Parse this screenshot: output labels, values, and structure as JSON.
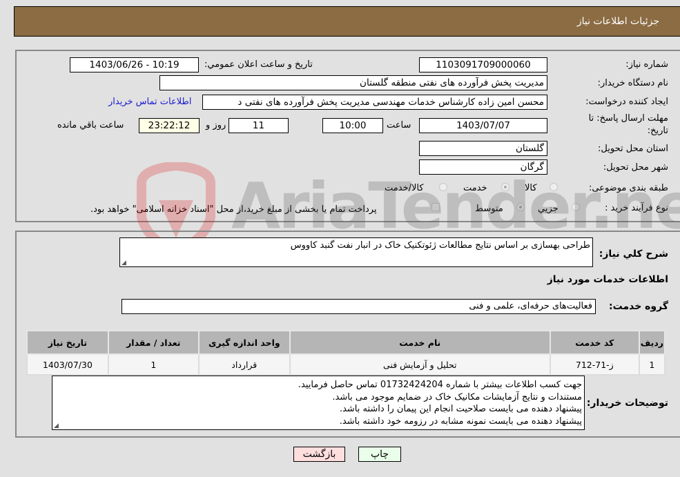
{
  "header": {
    "title": "جزئیات اطلاعات نیاز"
  },
  "form": {
    "need_number_label": "شماره نیاز:",
    "need_number": "1103091709000060",
    "announce_label": "تاریخ و ساعت اعلان عمومي:",
    "announce_value": "1403/06/26 - 10:19",
    "buyer_org_label": "نام دستگاه خریدار:",
    "buyer_org": "مدیریت پخش فرآورده های نفتی منطقه گلستان",
    "creator_label": "ایجاد کننده درخواست:",
    "creator": "محسن امین زاده کارشناس خدمات مهندسی مدیریت پخش فرآورده های نفتی د",
    "contact_link": "اطلاعات تماس خریدار",
    "deadline_label_line1": "مهلت ارسال پاسخ: تا",
    "deadline_label_line2": "تاریخ:",
    "deadline_date": "1403/07/07",
    "time_label": "ساعت",
    "deadline_time": "10:00",
    "days_value": "11",
    "days_label": "روز و",
    "remaining_time": "23:22:12",
    "remaining_label": "ساعت باقي مانده",
    "province_label": "استان محل تحویل:",
    "province": "گلستان",
    "city_label": "شهر محل تحویل:",
    "city": "گرگان",
    "category_label": "طبقه بندی موضوعی:",
    "category_options": [
      "کالا",
      "خدمت",
      "کالا/خدمت"
    ],
    "category_selected": "خدمت",
    "process_label": "نوع فرآیند خرید :",
    "process_options": [
      "جزيي",
      "متوسط"
    ],
    "process_selected": "متوسط",
    "treasury_note": "پرداخت تمام یا بخشی از مبلغ خرید،از محل \"اسناد خزانه اسلامی\" خواهد بود."
  },
  "details": {
    "summary_label": "شرح کلي نیاز:",
    "summary": "طراحی بهسازی بر اساس نتایج مطالعات ژئوتکنیک خاک در انبار نفت گنبد کاووس",
    "services_title": "اطلاعات خدمات مورد نیاز",
    "service_group_label": "گروه خدمت:",
    "service_group": "فعالیت‌های حرفه‌ای، علمی و فنی",
    "table": {
      "headers": [
        "ردیف",
        "کد خدمت",
        "نام خدمت",
        "واحد اندازه گیری",
        "تعداد / مقدار",
        "تاریخ نیاز"
      ],
      "rows": [
        [
          "1",
          "ز-71-712",
          "تحلیل و آزمایش فنی",
          "قرارداد",
          "1",
          "1403/07/30"
        ]
      ]
    },
    "buyer_notes_label": "توضیحات خریدار:",
    "buyer_notes": [
      "جهت کسب اطلاعات بیشتر با شماره 01732424204 تماس حاصل فرمایید.",
      "مستندات و نتایج آزمایشات مکانیک خاک در ضمایم موجود می باشد.",
      "پیشنهاد دهنده می بایست صلاحیت انجام این پیمان را داشته باشد.",
      "پیشنهاد دهنده می بایست نمونه مشابه در رزومه خود داشته باشد."
    ]
  },
  "buttons": {
    "print": "چاپ",
    "back": "بازگشت"
  },
  "watermark": {
    "text": "AriaTender.neT"
  },
  "colors": {
    "header_bg": "#8b6c43",
    "link": "#1a1ad0",
    "print_bg": "#eaffea",
    "back_bg": "#ffdede",
    "remaining_bg": "#ffffe6"
  }
}
